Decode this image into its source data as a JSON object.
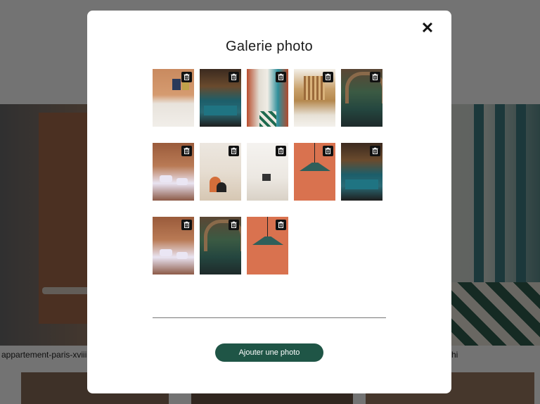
{
  "background": {
    "caption_left": "appartement-paris-xviii",
    "caption_right": "hi"
  },
  "modal": {
    "title": "Galerie photo",
    "close_icon": "close-icon",
    "add_button_label": "Ajouter une photo",
    "delete_icon": "trash-icon",
    "photos": [
      {
        "scene": "lounge"
      },
      {
        "scene": "bar"
      },
      {
        "scene": "corridor"
      },
      {
        "scene": "wood"
      },
      {
        "scene": "arch"
      },
      {
        "scene": "terrace"
      },
      {
        "scene": "beige"
      },
      {
        "scene": "white"
      },
      {
        "scene": "lamp"
      },
      {
        "scene": "bar"
      },
      {
        "scene": "terrace"
      },
      {
        "scene": "arch"
      },
      {
        "scene": "lamp"
      }
    ]
  },
  "colors": {
    "accent": "#1f5546",
    "overlay": "rgba(0,0,0,0.55)"
  }
}
